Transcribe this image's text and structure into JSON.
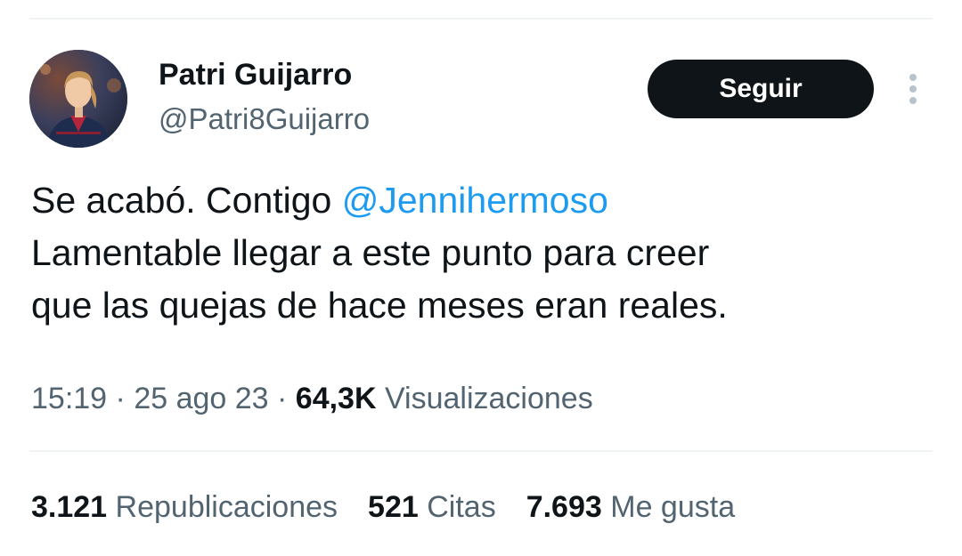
{
  "author": {
    "display_name": "Patri Guijarro",
    "handle": "@Patri8Guijarro"
  },
  "follow_button": {
    "label": "Seguir"
  },
  "more_icon": "vertical-ellipsis-icon",
  "tweet": {
    "lines": [
      {
        "text": "Se acabó. Contigo ",
        "mention": "@Jennihermoso"
      },
      {
        "text": "Lamentable llegar a este punto para creer"
      },
      {
        "text": "que las quejas de hace meses eran reales."
      }
    ]
  },
  "meta": {
    "time": "15:19",
    "separator": " · ",
    "date": "25 ago 23",
    "views_count": "64,3K",
    "views_label": "Visualizaciones"
  },
  "stats": {
    "reposts": {
      "count": "3.121",
      "label": "Republicaciones"
    },
    "quotes": {
      "count": "521",
      "label": "Citas"
    },
    "likes": {
      "count": "7.693",
      "label": "Me gusta"
    }
  },
  "colors": {
    "text": "#0f1419",
    "secondary": "#536471",
    "link": "#1d9bf0",
    "button_bg": "#0f1419",
    "divider": "#eff3f4"
  }
}
